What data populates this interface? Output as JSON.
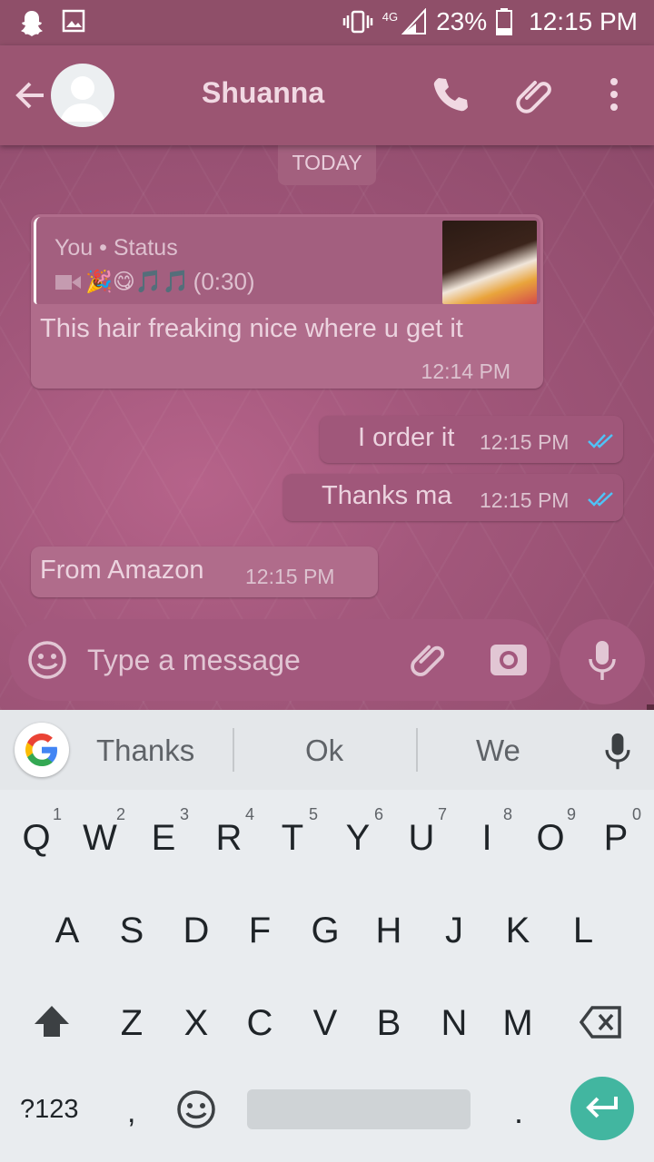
{
  "status_bar": {
    "network": "4G",
    "battery": "23%",
    "time": "12:15 PM"
  },
  "header": {
    "contact_name": "Shuanna"
  },
  "chat": {
    "date_label": "TODAY",
    "reply_message": {
      "quote_author": "You • Status",
      "quote_content": "🎉😋🎵🎵",
      "quote_duration": "(0:30)",
      "text": "This hair freaking nice where u get it",
      "time": "12:14 PM"
    },
    "outgoing": [
      {
        "text": "I order it",
        "time": "12:15 PM"
      },
      {
        "text": "Thanks ma",
        "time": "12:15 PM"
      }
    ],
    "incoming_last": {
      "text": "From Amazon",
      "time": "12:15 PM"
    }
  },
  "composer": {
    "placeholder": "Type a message"
  },
  "keyboard": {
    "suggestions": [
      "Thanks",
      "Ok",
      "We"
    ],
    "row1": [
      "Q",
      "W",
      "E",
      "R",
      "T",
      "Y",
      "U",
      "I",
      "O",
      "P"
    ],
    "row1_hints": [
      "1",
      "2",
      "3",
      "4",
      "5",
      "6",
      "7",
      "8",
      "9",
      "0"
    ],
    "row2": [
      "A",
      "S",
      "D",
      "F",
      "G",
      "H",
      "J",
      "K",
      "L"
    ],
    "row3": [
      "Z",
      "X",
      "C",
      "V",
      "B",
      "N",
      "M"
    ],
    "symbols_key": "?123",
    "comma_key": ",",
    "period_key": "."
  },
  "colors": {
    "header": "#9b5572",
    "tick": "#4fc3f7",
    "enter_key": "#42b6a0"
  }
}
